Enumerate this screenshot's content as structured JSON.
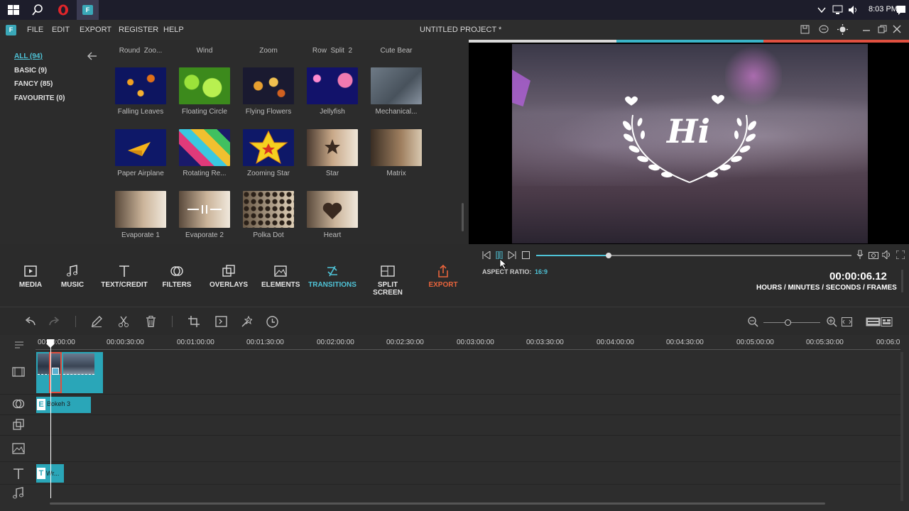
{
  "taskbar": {
    "time": "8:03 PM",
    "icons": [
      "windows-start-icon",
      "search-icon",
      "opera-icon",
      "filmora-icon",
      "chevron-up-icon",
      "network-icon",
      "volume-icon",
      "notification-icon"
    ]
  },
  "menu": {
    "items": [
      "FILE",
      "EDIT",
      "EXPORT",
      "REGISTER",
      "HELP"
    ],
    "project_title": "UNTITLED PROJECT *"
  },
  "categories": [
    {
      "label": "ALL (94)",
      "selected": true
    },
    {
      "label": "BASIC (9)",
      "selected": false
    },
    {
      "label": "FANCY (85)",
      "selected": false
    },
    {
      "label": "FAVOURITE (0)",
      "selected": false
    }
  ],
  "library": {
    "top_row_partial": [
      "Round_Zoo...",
      "Wind",
      "Zoom",
      "Row_Split_2",
      "Cute Bear"
    ],
    "items": [
      {
        "label": "Falling Leaves"
      },
      {
        "label": "Floating Circle"
      },
      {
        "label": "Flying Flowers"
      },
      {
        "label": "Jellyfish"
      },
      {
        "label": "Mechanical..."
      },
      {
        "label": "Paper Airplane"
      },
      {
        "label": "Rotating Re..."
      },
      {
        "label": "Zooming Star"
      },
      {
        "label": "Star"
      },
      {
        "label": "Matrix"
      },
      {
        "label": "Evaporate 1"
      },
      {
        "label": "Evaporate 2"
      },
      {
        "label": "Polka Dot"
      },
      {
        "label": "Heart"
      }
    ]
  },
  "preview": {
    "overlay_text": "Hi",
    "aspect_ratio_label": "ASPECT RATIO:",
    "aspect_ratio_value": "16:9",
    "timecode": "00:00:06.12",
    "timecode_format": "HOURS / MINUTES / SECONDS / FRAMES",
    "playhead_progress": 0.23
  },
  "toolbar": {
    "media": "MEDIA",
    "music": "MUSIC",
    "text_credit": "TEXT/CREDIT",
    "filters": "FILTERS",
    "overlays": "OVERLAYS",
    "elements": "ELEMENTS",
    "transitions": "TRANSITIONS",
    "split_screen": "SPLIT SCREEN",
    "export": "EXPORT"
  },
  "timeline": {
    "ruler": [
      "00:00:00:00",
      "00:00:30:00",
      "00:01:00:00",
      "00:01:30:00",
      "00:02:00:00",
      "00:02:30:00",
      "00:03:00:00",
      "00:03:30:00",
      "00:04:00:00",
      "00:04:30:00",
      "00:05:00:00",
      "00:05:30:00",
      "00:06:0"
    ],
    "filter_clip_badge": "E",
    "filter_clip_label": "Bokeh 3",
    "text_clip_badge": "T",
    "text_clip_label": "Wr..."
  },
  "colors": {
    "accent": "#4fc3d7",
    "export": "#e8643c",
    "clip": "#2aa6b8"
  }
}
